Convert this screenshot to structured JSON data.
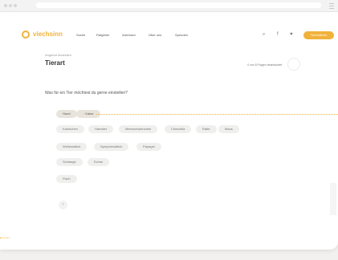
{
  "nav": {
    "brand": "viechsinn",
    "items": [
      "Suche",
      "Ratgeber",
      "Adressen",
      "Über uns",
      "Spenden"
    ],
    "icons": [
      "search-icon",
      "facebook-icon",
      "twitter-icon"
    ],
    "cta": "Tierhalter/in"
  },
  "breadcrumb": "Angebot einstellen",
  "title": "Tierart",
  "progress": {
    "text": "0 von 8 Fragen beantwortet",
    "value": 0
  },
  "question": "Was für ein Tier möchtest du gerne einstellen?",
  "chips": [
    "Hund",
    "Katze",
    "Kaninchen",
    "Hamster",
    "Meerschweinchen",
    "Chinchilla",
    "Ratte",
    "Maus",
    "Wellensittich",
    "Nymphensittich",
    "Papagei",
    "Schlange",
    "Echse",
    "Fisch"
  ],
  "back_button": "‹",
  "colors": {
    "accent": "#f0b23b",
    "chip": "#efefee"
  }
}
